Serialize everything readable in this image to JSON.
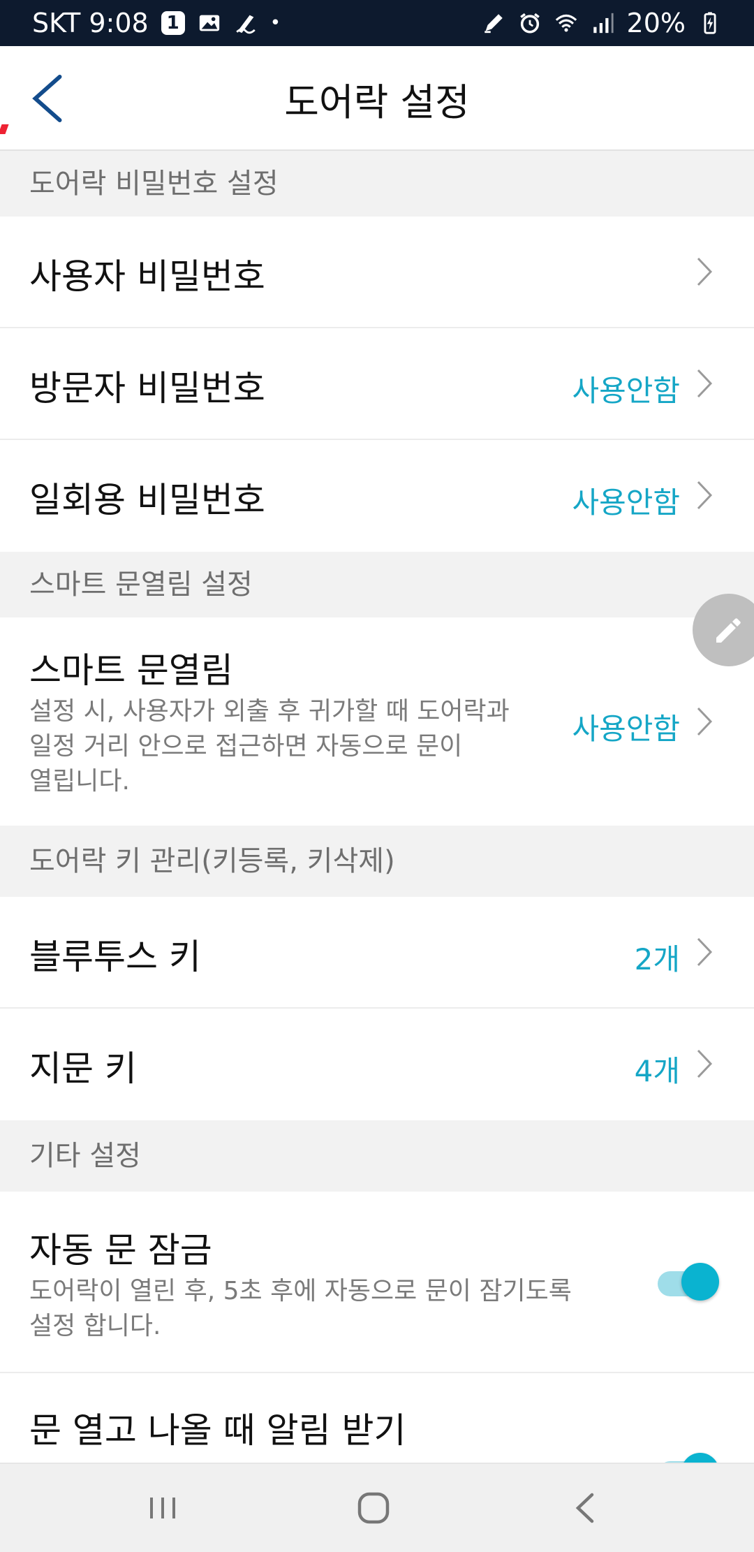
{
  "status_bar": {
    "carrier_time": "SKT 9:08",
    "notif_count": "1",
    "battery": "20%",
    "icons": [
      "image-icon",
      "signature-icon",
      "dot-icon",
      "pen-icon",
      "alarm-icon",
      "wifi-icon",
      "signal-icon",
      "battery-charging-icon"
    ]
  },
  "app_bar": {
    "title": "도어락 설정",
    "back_icon": "chevron-left-icon"
  },
  "sections": {
    "password": {
      "header": "도어락 비밀번호 설정",
      "user_password": {
        "title": "사용자 비밀번호",
        "value": ""
      },
      "visitor_password": {
        "title": "방문자 비밀번호",
        "value": "사용안함"
      },
      "onetime_password": {
        "title": "일회용 비밀번호",
        "value": "사용안함"
      }
    },
    "smart_open": {
      "header": "스마트 문열림 설정",
      "item": {
        "title": "스마트 문열림",
        "desc_line1": "설정 시, 사용자가 외출 후 귀가할 때 도어락과",
        "desc_line2": "일정 거리 안으로 접근하면 자동으로 문이",
        "desc_line3": "열립니다.",
        "value": "사용안함"
      }
    },
    "keys": {
      "header": "도어락 키 관리(키등록, 키삭제)",
      "bluetooth": {
        "title": "블루투스 키",
        "value": "2개"
      },
      "fingerprint": {
        "title": "지문 키",
        "value": "4개"
      }
    },
    "other": {
      "header": "기타 설정",
      "auto_lock": {
        "title": "자동 문 잠금",
        "desc_line1": "도어락이 열린 후, 5초 후에 자동으로 문이 잠기도록",
        "desc_line2": "설정 합니다.",
        "enabled": true
      },
      "exit_alert": {
        "title": "문 열고 나올 때 알림 받기",
        "enabled": true
      }
    }
  },
  "fab_icon": "pencil-icon",
  "nav_bar": {
    "icons": [
      "recent-apps-icon",
      "home-icon",
      "back-icon"
    ]
  },
  "colors": {
    "accent": "#15a6c6",
    "toggle_on": "#0ab3d0",
    "status_bar_bg": "#0d1a2e"
  }
}
